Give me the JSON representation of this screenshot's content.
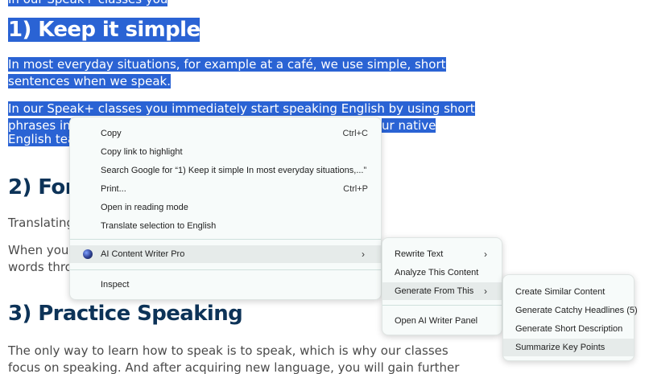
{
  "article": {
    "clipped_text": "In our Speak+ classes you",
    "h1": "1) Keep it simple",
    "p1_l1": "In most everyday situations, for example at a café, we use simple, short",
    "p1_l2": "sentences when we speak.",
    "p2_l1": "In our Speak+ classes you immediately start speaking English by using short",
    "p2_l2_a": "phrases in",
    "p2_l2_b": "ur native",
    "p2_l3": "English tea",
    "h2": "2) Forg",
    "p3": "Translating",
    "p4_l1": "When you",
    "p4_l2": "words thro",
    "h3": "3) Practice Speaking",
    "p5_l1": "The only way to learn how to speak is to speak, which is why our classes",
    "p5_l2": "focus on speaking. And after acquiring new language, you will gain further"
  },
  "context_menu": {
    "copy": "Copy",
    "copy_shortcut": "Ctrl+C",
    "copy_link": "Copy link to highlight",
    "search_google": "Search Google for “1) Keep it simple In most everyday situations,...”",
    "print": "Print...",
    "print_shortcut": "Ctrl+P",
    "reading_mode": "Open in reading mode",
    "translate": "Translate selection to English",
    "ai_writer": "AI Content Writer Pro",
    "inspect": "Inspect",
    "chevron": "›"
  },
  "ai_submenu": {
    "rewrite": "Rewrite Text",
    "analyze": "Analyze This Content",
    "generate": "Generate From This",
    "open_panel": "Open AI Writer Panel"
  },
  "generate_submenu": {
    "similar": "Create Similar Content",
    "headlines": "Generate Catchy Headlines (5)",
    "short_desc": "Generate Short Description",
    "summarize": "Summarize Key Points"
  },
  "colors": {
    "selection": "#2a63d4",
    "heading": "#0d3358",
    "menu_bg": "#f7fbfa",
    "menu_highlight": "#e6ebea"
  }
}
